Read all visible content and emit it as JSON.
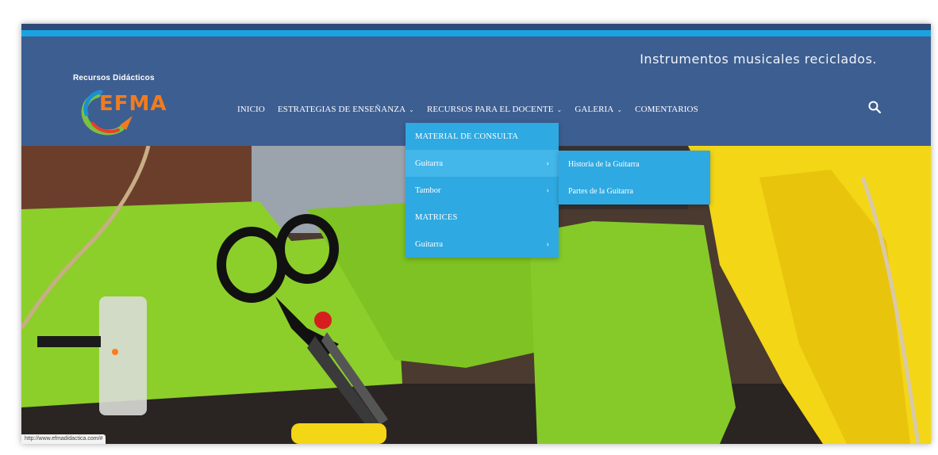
{
  "site": {
    "tagline": "Instrumentos musicales reciclados.",
    "brand_caption": "Recursos Didácticos",
    "logo_text": "EFMA"
  },
  "nav": {
    "items": [
      {
        "label": "INICIO",
        "has_submenu": false
      },
      {
        "label": "ESTRATEGIAS DE ENSEÑANZA",
        "has_submenu": true
      },
      {
        "label": "RECURSOS PARA EL DOCENTE",
        "has_submenu": true
      },
      {
        "label": "GALERIA",
        "has_submenu": true
      },
      {
        "label": "COMENTARIOS",
        "has_submenu": false
      }
    ],
    "chevron": "⌄",
    "search_icon": "search-icon"
  },
  "dropdown": {
    "items": [
      {
        "label": "MATERIAL DE CONSULTA",
        "arrow": ""
      },
      {
        "label": "Guitarra",
        "arrow": "›"
      },
      {
        "label": "Tambor",
        "arrow": "›"
      },
      {
        "label": "MATRICES",
        "arrow": ""
      },
      {
        "label": "Guitarra",
        "arrow": "›"
      }
    ]
  },
  "subdropdown": {
    "items": [
      {
        "label": "Historia de la Guitarra"
      },
      {
        "label": "Partes de la Guitarra"
      }
    ]
  },
  "status": {
    "url": "http://www.efmadidactica.com/#"
  },
  "colors": {
    "header_bg": "#3d5e91",
    "accent": "#1aa3e0",
    "menu_bg": "#2fa9e1",
    "logo_orange": "#f07c1e",
    "felt_green": "#8ccf2a",
    "fabric_yellow": "#f3d616"
  }
}
